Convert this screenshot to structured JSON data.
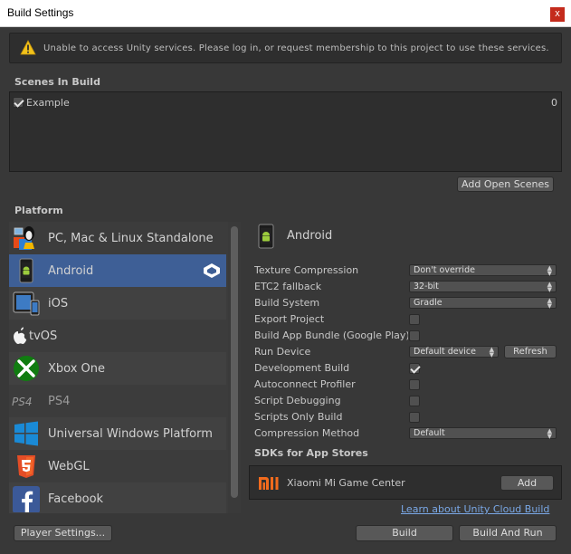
{
  "window": {
    "title": "Build Settings",
    "close_glyph": "x"
  },
  "warning": {
    "icon": "warning-icon",
    "text": "Unable to access Unity services. Please log in, or request membership to this project to use these services."
  },
  "scenes": {
    "header": "Scenes In Build",
    "items": [
      {
        "name": "Example",
        "checked": true,
        "index": "0"
      }
    ],
    "add_open_scenes": "Add Open Scenes"
  },
  "platform": {
    "header": "Platform",
    "items": [
      {
        "label": "PC, Mac & Linux Standalone",
        "icon": "standalone-icon"
      },
      {
        "label": "Android",
        "icon": "android-icon",
        "selected": true,
        "active": true
      },
      {
        "label": "iOS",
        "icon": "ios-icon"
      },
      {
        "label": "tvOS",
        "icon": "tvos-icon"
      },
      {
        "label": "Xbox One",
        "icon": "xbox-icon"
      },
      {
        "label": "PS4",
        "icon": "ps4-icon",
        "dimmed": true
      },
      {
        "label": "Universal Windows Platform",
        "icon": "windows-icon"
      },
      {
        "label": "WebGL",
        "icon": "html5-icon"
      },
      {
        "label": "Facebook",
        "icon": "facebook-icon"
      }
    ]
  },
  "settings": {
    "platform_title": "Android",
    "rows": {
      "texture_compression": {
        "label": "Texture Compression",
        "value": "Don't override"
      },
      "etc2_fallback": {
        "label": "ETC2 fallback",
        "value": "32-bit"
      },
      "build_system": {
        "label": "Build System",
        "value": "Gradle"
      },
      "export_project": {
        "label": "Export Project",
        "checked": false
      },
      "build_app_bundle": {
        "label": "Build App Bundle (Google Play)",
        "checked": false
      },
      "run_device": {
        "label": "Run Device",
        "value": "Default device",
        "refresh": "Refresh"
      },
      "development_build": {
        "label": "Development Build",
        "checked": true
      },
      "autoconnect_profiler": {
        "label": "Autoconnect Profiler",
        "checked": false
      },
      "script_debugging": {
        "label": "Script Debugging",
        "checked": false
      },
      "scripts_only_build": {
        "label": "Scripts Only Build",
        "checked": false
      },
      "compression_method": {
        "label": "Compression Method",
        "value": "Default"
      }
    },
    "sdk_header": "SDKs for App Stores",
    "sdk": {
      "name": "Xiaomi Mi Game Center",
      "button": "Add",
      "icon": "xiaomi-icon"
    },
    "cloud_link": "Learn about Unity Cloud Build"
  },
  "footer": {
    "player_settings": "Player Settings...",
    "build": "Build",
    "build_and_run": "Build And Run"
  },
  "colors": {
    "background": "#383838",
    "selection": "#3e5f96",
    "link": "#7aa8e6"
  }
}
